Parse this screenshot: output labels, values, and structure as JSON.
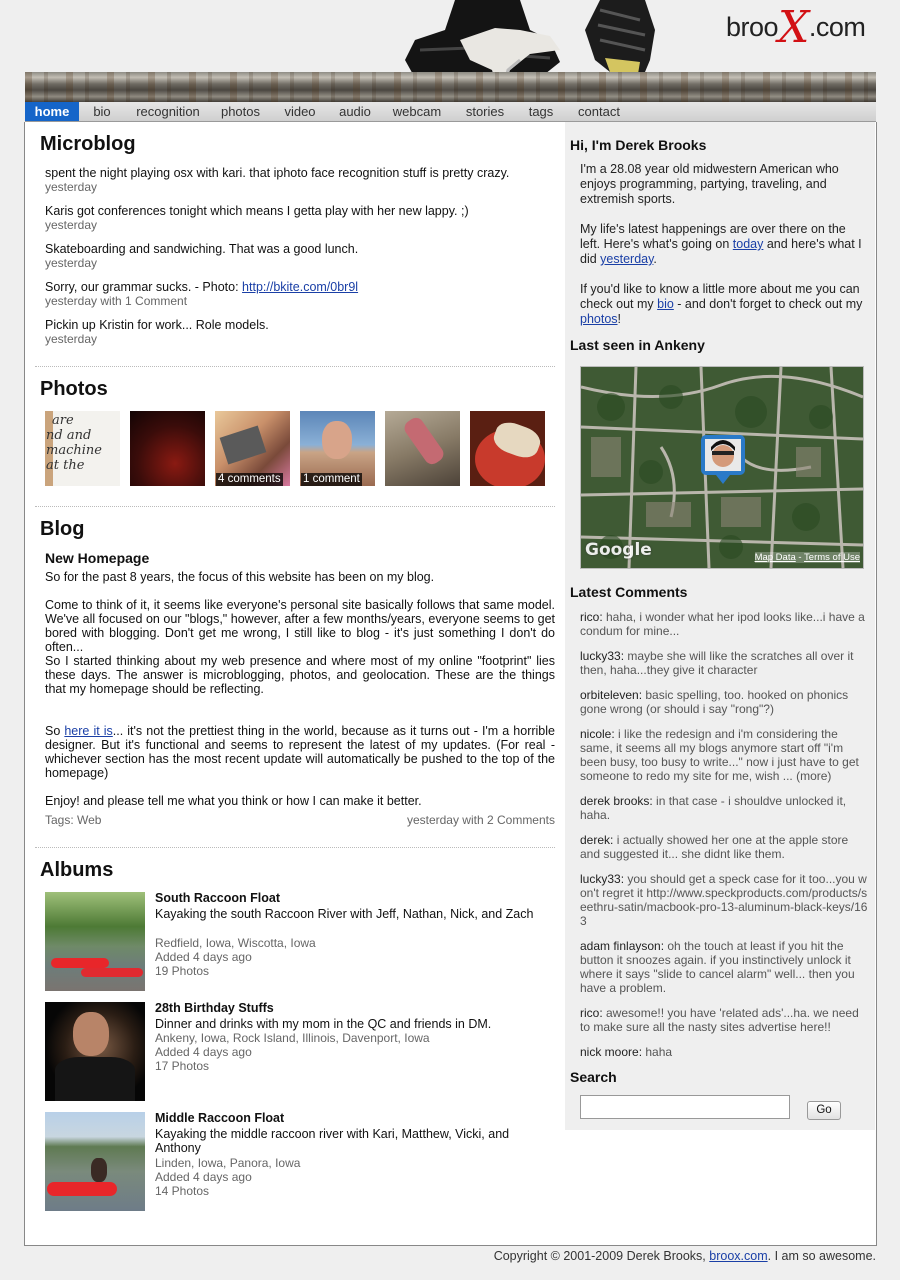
{
  "header": {
    "logo_pre": "broo",
    "logo_x": "X",
    "logo_post": ".com"
  },
  "nav": [
    {
      "label": "home",
      "active": true
    },
    {
      "label": "bio"
    },
    {
      "label": "recognition"
    },
    {
      "label": "photos"
    },
    {
      "label": "video"
    },
    {
      "label": "audio"
    },
    {
      "label": "webcam"
    },
    {
      "label": "stories"
    },
    {
      "label": "tags"
    },
    {
      "label": "contact"
    }
  ],
  "microblog": {
    "title": "Microblog",
    "posts": [
      {
        "text": "spent the night playing osx with kari. that iphoto face recognition stuff is pretty crazy.",
        "meta": "yesterday"
      },
      {
        "text": "Karis got conferences tonight which means I getta play with her new lappy. ;)",
        "meta": "yesterday"
      },
      {
        "text": "Skateboarding and sandwiching. That was a good lunch.",
        "meta": "yesterday"
      },
      {
        "text": "Sorry, our grammar sucks. - Photo: ",
        "link": "http://bkite.com/0br9l",
        "meta": "yesterday with 1 Comment"
      },
      {
        "text": "Pickin up Kristin for work... Role models.",
        "meta": "yesterday"
      }
    ]
  },
  "photos": {
    "title": "Photos",
    "items": [
      {
        "caption": ""
      },
      {
        "caption": ""
      },
      {
        "caption": "4 comments"
      },
      {
        "caption": "1 comment"
      },
      {
        "caption": ""
      },
      {
        "caption": ""
      }
    ],
    "handwriting": [
      "are",
      "nd and",
      "machine",
      "at the"
    ]
  },
  "blog": {
    "title": "Blog",
    "post_title": "New Homepage",
    "p1": "So for the past 8 years, the focus of this website has been on my blog.",
    "p2": "Come to think of it, it seems like everyone's personal site basically follows that same model. We've all focused on our \"blogs,\" however, after a few months/years, everyone seems to get bored with blogging. Don't get me wrong, I still like to blog - it's just something I don't do often...",
    "p3": "So I started thinking about my web presence and where most of my online \"footprint\" lies these days. The answer is microblogging, photos, and geolocation. These are the things that my homepage should be reflecting.",
    "p4_pre": "So ",
    "p4_link": "here it is",
    "p4_post": "... it's not the prettiest thing in the world, because as it turns out - I'm a horrible designer. But it's functional and seems to represent the latest of my updates. (For real - whichever section has the most recent update will automatically be pushed to the top of the homepage)",
    "p5": "Enjoy! and please tell me what you think or how I can make it better.",
    "tags": "Tags: Web",
    "meta": "yesterday with 2 Comments"
  },
  "albums": {
    "title": "Albums",
    "items": [
      {
        "title": "South Raccoon Float",
        "desc": "Kayaking the south Raccoon River with Jeff, Nathan, Nick, and Zach",
        "places": "Redfield, Iowa, Wiscotta, Iowa",
        "added": "Added 4 days ago",
        "count": "19 Photos"
      },
      {
        "title": "28th Birthday Stuffs",
        "desc": "Dinner and drinks with my mom in the QC and friends in DM.",
        "places": "Ankeny, Iowa, Rock Island, Illinois, Davenport, Iowa",
        "added": "Added 4 days ago",
        "count": "17 Photos"
      },
      {
        "title": "Middle Raccoon Float",
        "desc": "Kayaking the middle raccoon river with Kari, Matthew, Vicki, and Anthony",
        "places": "Linden, Iowa, Panora, Iowa",
        "added": "Added 4 days ago",
        "count": "14 Photos"
      }
    ]
  },
  "sidebar": {
    "intro_title": "Hi, I'm Derek Brooks",
    "intro_p1": "I'm a 28.08 year old midwestern American who enjoys programming, partying, traveling, and extremish sports.",
    "intro_p2_a": "My life's latest happenings are over there on the left. Here's what's going on ",
    "intro_p2_link1": "today",
    "intro_p2_b": " and here's what I did ",
    "intro_p2_link2": "yesterday",
    "intro_p2_c": ".",
    "intro_p3_a": "If you'd like to know a little more about me you can check out my ",
    "intro_p3_link1": "bio",
    "intro_p3_b": " - and don't forget to check out my ",
    "intro_p3_link2": "photos",
    "intro_p3_c": "!",
    "map_title": "Last seen in Ankeny",
    "map_google": "Google",
    "map_data": "Map Data",
    "map_sep": " - ",
    "map_terms": "Terms of Use",
    "comments_title": "Latest Comments",
    "comments": [
      {
        "who": "rico:",
        "text": " haha, i wonder what her ipod looks like...i have a condum for mine..."
      },
      {
        "who": "lucky33:",
        "text": " maybe she will like the scratches all over it then, haha...they give it character"
      },
      {
        "who": "orbiteleven:",
        "text": " basic spelling, too. hooked on phonics gone wrong (or should i say \"rong\"?)"
      },
      {
        "who": "nicole:",
        "text": " i like the redesign and i'm considering the same, it seems all my blogs anymore start off \"i'm been busy, too busy to write...\" now i just have to get someone to redo my site for me, wish ... (more)"
      },
      {
        "who": "derek brooks:",
        "text": " in that case - i shouldve unlocked it, haha."
      },
      {
        "who": "derek:",
        "text": " i actually showed her one at the apple store and suggested it... she didnt like them."
      },
      {
        "who": "lucky33:",
        "text": " you should get a speck case for it too...you won't regret it http://www.speckproducts.com/products/seethru-satin/macbook-pro-13-aluminum-black-keys/163"
      },
      {
        "who": "adam finlayson:",
        "text": " oh the touch at least if you hit the button it snoozes again. if you instinctively unlock it where it says \"slide to cancel alarm\" well... then you have a problem."
      },
      {
        "who": "rico:",
        "text": " awesome!! you have 'related ads'...ha. we need to make sure all the nasty sites advertise here!!"
      },
      {
        "who": "nick moore:",
        "text": " haha"
      }
    ],
    "search_title": "Search",
    "search_value": "",
    "go_label": "Go"
  },
  "footer": {
    "pre": "Copyright © 2001-2009 Derek Brooks, ",
    "link": "broox.com",
    "post": ". I am so awesome."
  },
  "colors": {
    "accent": "#1565c9",
    "link": "#1a3fa6",
    "logo_x": "#d21014"
  }
}
